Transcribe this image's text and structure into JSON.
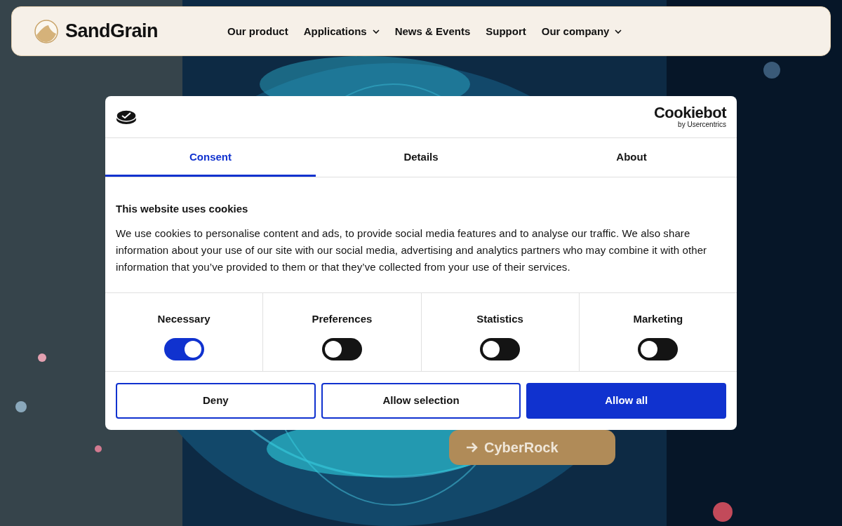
{
  "header": {
    "logo": "SandGrain",
    "nav": [
      {
        "label": "Our product",
        "dropdown": false
      },
      {
        "label": "Applications",
        "dropdown": true
      },
      {
        "label": "News & Events",
        "dropdown": false
      },
      {
        "label": "Support",
        "dropdown": false
      },
      {
        "label": "Our company",
        "dropdown": true
      }
    ]
  },
  "hero": {
    "button": "CyberRock"
  },
  "cookie_dialog": {
    "brand": "Cookiebot",
    "brand_sub": "by Usercentrics",
    "tabs": [
      {
        "label": "Consent",
        "selected": true
      },
      {
        "label": "Details",
        "selected": false
      },
      {
        "label": "About",
        "selected": false
      }
    ],
    "heading": "This website uses cookies",
    "body": "We use cookies to personalise content and ads, to provide social media features and to analyse our traffic. We also share information about your use of our site with our social media, advertising and analytics partners who may combine it with other information that you’ve provided to them or that they’ve collected from your use of their services.",
    "categories": [
      {
        "label": "Necessary",
        "on": true
      },
      {
        "label": "Preferences",
        "on": false
      },
      {
        "label": "Statistics",
        "on": false
      },
      {
        "label": "Marketing",
        "on": false
      }
    ],
    "buttons": [
      {
        "label": "Deny",
        "kind": "outline"
      },
      {
        "label": "Allow selection",
        "kind": "outline"
      },
      {
        "label": "Allow all",
        "kind": "primary"
      }
    ]
  }
}
